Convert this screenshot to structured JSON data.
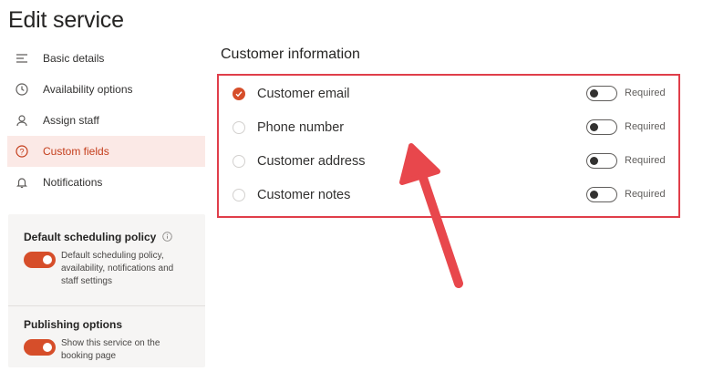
{
  "page": {
    "title": "Edit service"
  },
  "nav": {
    "items": [
      {
        "label": "Basic details",
        "icon": "lines-icon",
        "active": false
      },
      {
        "label": "Availability options",
        "icon": "clock-icon",
        "active": false
      },
      {
        "label": "Assign staff",
        "icon": "person-icon",
        "active": false
      },
      {
        "label": "Custom fields",
        "icon": "question-circle-icon",
        "active": true
      },
      {
        "label": "Notifications",
        "icon": "bell-icon",
        "active": false
      }
    ]
  },
  "policy": {
    "default": {
      "title": "Default scheduling policy",
      "description": "Default scheduling policy, availability, notifications and staff settings",
      "enabled": true
    },
    "publishing": {
      "title": "Publishing options",
      "description": "Show this service on the booking page",
      "enabled": true
    }
  },
  "customer_info": {
    "heading": "Customer information",
    "fields": [
      {
        "label": "Customer email",
        "checked": true,
        "required_label": "Required",
        "required": false
      },
      {
        "label": "Phone number",
        "checked": false,
        "required_label": "Required",
        "required": false
      },
      {
        "label": "Customer address",
        "checked": false,
        "required_label": "Required",
        "required": false
      },
      {
        "label": "Customer notes",
        "checked": false,
        "required_label": "Required",
        "required": false
      }
    ]
  },
  "colors": {
    "accent": "#d64e2a",
    "active_nav_bg": "#fbe9e6",
    "annotation_red": "#e03e4a"
  }
}
